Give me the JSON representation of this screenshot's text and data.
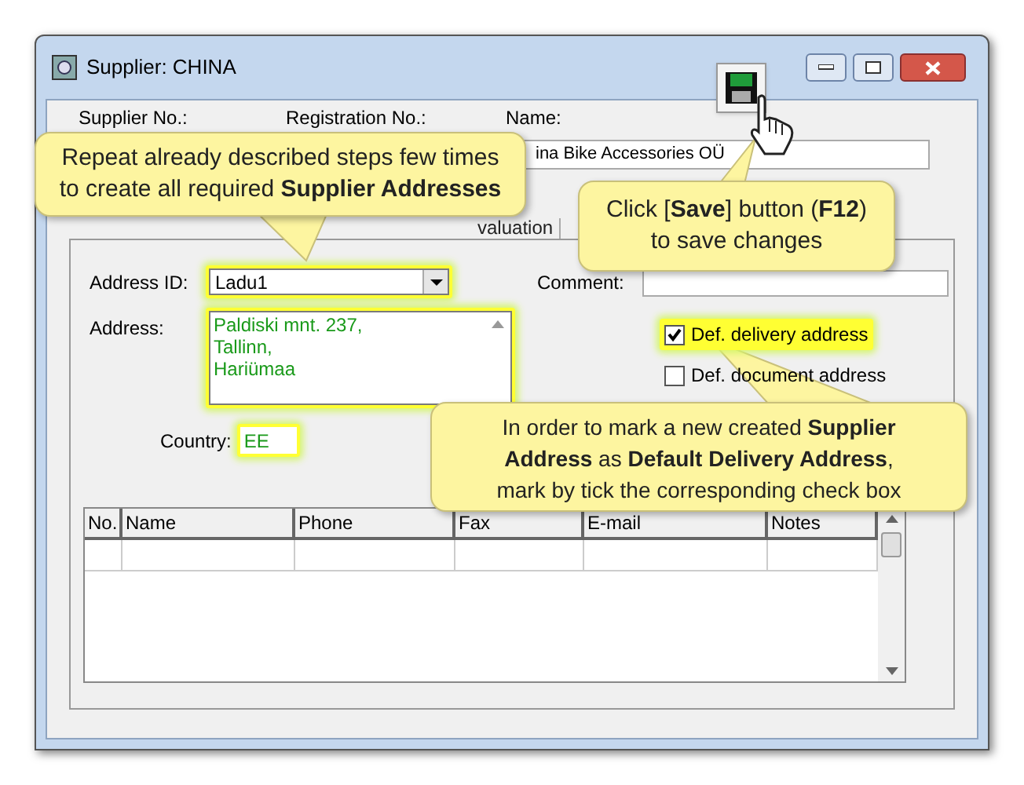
{
  "window": {
    "title": "Supplier: CHINA"
  },
  "header_fields": [
    {
      "label": "Supplier No.:"
    },
    {
      "label": "Registration No.:"
    },
    {
      "label": "Name:",
      "value": "ina Bike Accessories OÜ"
    }
  ],
  "tabs": [
    {
      "label": "valuation"
    }
  ],
  "address_form": {
    "address_id": {
      "label": "Address ID:",
      "value": "Ladu1",
      "highlighted": true
    },
    "comment": {
      "label": "Comment:"
    },
    "address": {
      "label": "Address:",
      "lines": [
        "Paldiski mnt. 237,",
        "Tallinn,",
        "Hariümaa"
      ],
      "highlighted": true
    },
    "country": {
      "label": "Country:",
      "value": "EE",
      "highlighted": true
    }
  },
  "checkboxes": [
    {
      "label": "Def. delivery address",
      "checked": true,
      "highlighted": true
    },
    {
      "label": "Def. document address",
      "checked": false,
      "highlighted": false
    }
  ],
  "table": {
    "columns": [
      "No.",
      "Name",
      "Phone",
      "Fax",
      "E-mail",
      "Notes"
    ]
  },
  "callouts": [
    {
      "kind": "repeat",
      "lines": [
        "Repeat already described steps few times",
        "to create all required **Supplier Addresses**"
      ]
    },
    {
      "kind": "save",
      "lines": [
        "Click [**Save**] button (**F12**)",
        "to save changes"
      ]
    },
    {
      "kind": "checkbox",
      "lines": [
        "In order to mark a new created **Supplier**",
        "**Address** as **Default Delivery Address**,",
        "mark by tick the corresponding check box"
      ]
    }
  ]
}
